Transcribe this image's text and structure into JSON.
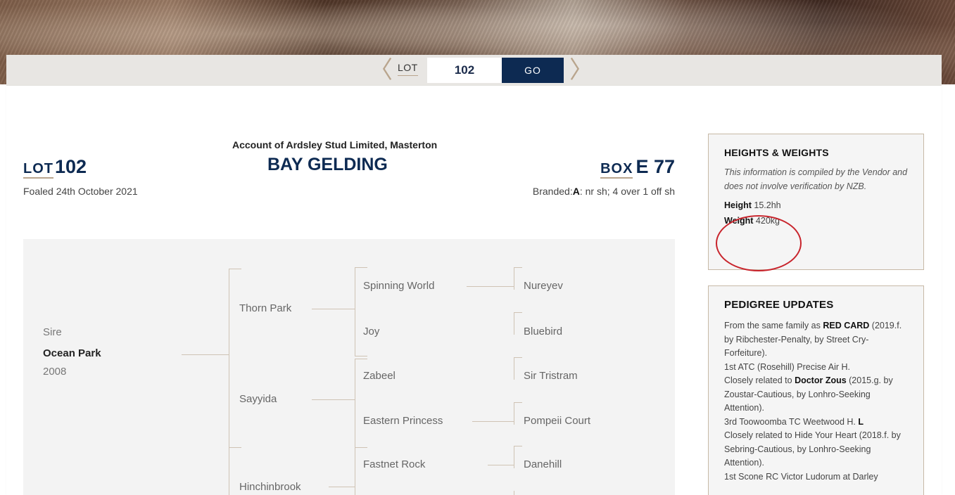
{
  "nav": {
    "prev_symbol": "〈",
    "next_symbol": "〉",
    "lot_label": "LOT",
    "lot_value": "102",
    "go_label": "GO"
  },
  "header": {
    "account": "Account of Ardsley Stud Limited, Masterton",
    "title": "BAY GELDING",
    "lot_label": "LOT",
    "lot_number": "102",
    "foaled": "Foaled 24th October 2021",
    "box_label": "BOX",
    "box_number": "E 77",
    "branded_label": "Branded:",
    "branded_mark": "A",
    "branded_text": ": nr sh; 4 over 1 off sh"
  },
  "pedigree": {
    "sire_label": "Sire",
    "sire_name": "Ocean Park",
    "sire_year": "2008",
    "gen2": [
      "Thorn Park",
      "Sayyida",
      "Hinchinbrook"
    ],
    "gen3": [
      "Spinning World",
      "Joy",
      "Zabeel",
      "Eastern Princess",
      "Fastnet Rock"
    ],
    "gen4": [
      "Nureyev",
      "Bluebird",
      "Sir Tristram",
      "Pompeii Court",
      "Danehill"
    ]
  },
  "heights_weights": {
    "title": "HEIGHTS & WEIGHTS",
    "note": "This information is compiled by the Vendor and does not involve verification by NZB.",
    "height_label": "Height",
    "height_value": "15.2hh",
    "weight_label": "Weight",
    "weight_value": "420kg"
  },
  "pedigree_updates": {
    "title": "PEDIGREE UPDATES",
    "p1_pre": "From the same family as ",
    "p1_bold": "RED CARD",
    "p1_post": " (2019.f. by Ribchester-Penalty, by Street Cry-Forfeiture).",
    "p2": "1st ATC (Rosehill) Precise Air H.",
    "p3_pre": "Closely related to ",
    "p3_bold": "Doctor Zous",
    "p3_post": " (2015.g. by Zoustar-Cautious, by Lonhro-Seeking Attention).",
    "p4_pre": "3rd Toowoomba TC Weetwood H. ",
    "p4_bold": "L",
    "p5": "Closely related to Hide Your Heart (2018.f. by Sebring-Cautious, by Lonhro-Seeking Attention).",
    "p6": "1st Scone RC Victor Ludorum at Darley"
  },
  "colors": {
    "navy": "#0d2a52",
    "tan": "#b9a58d",
    "annotation_red": "#c8242c"
  }
}
